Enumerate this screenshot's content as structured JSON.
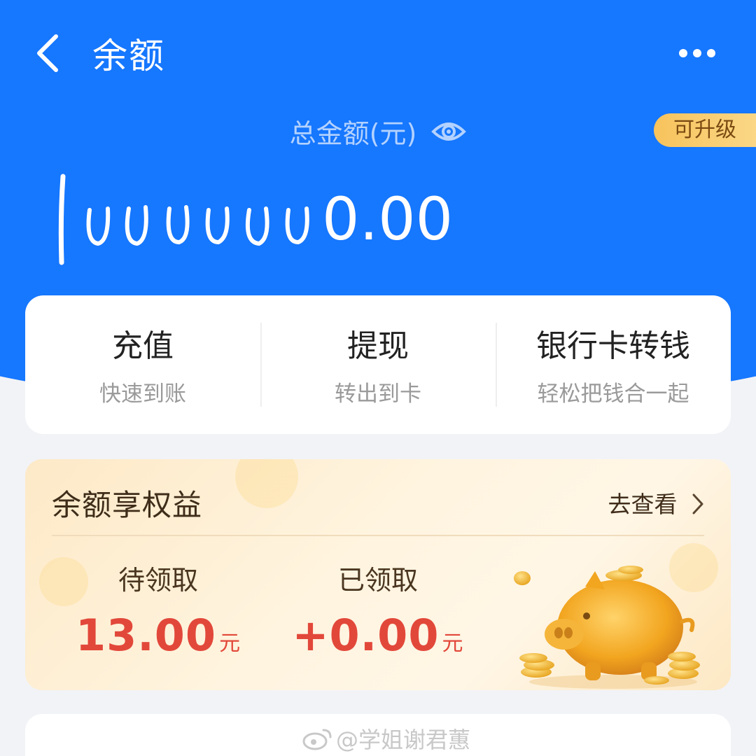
{
  "nav": {
    "title": "余额",
    "back_icon": "chevron-left-icon",
    "more_icon": "more-dots-icon"
  },
  "summary": {
    "total_label": "总金额(元)",
    "eye_icon": "eye-icon",
    "upgrade_label": "可升级",
    "amount_handwritten": "1",
    "amount_display": "0000000.00"
  },
  "actions": [
    {
      "title": "充值",
      "subtitle": "快速到账"
    },
    {
      "title": "提现",
      "subtitle": "转出到卡"
    },
    {
      "title": "银行卡转钱",
      "subtitle": "轻松把钱合一起"
    }
  ],
  "benefits": {
    "title": "余额享权益",
    "view_label": "去查看",
    "pending": {
      "label": "待领取",
      "value": "13.00",
      "unit": "元"
    },
    "received": {
      "label": "已领取",
      "value": "+0.00",
      "unit": "元"
    }
  },
  "watermark": {
    "text": "@学姐谢君蕙"
  },
  "colors": {
    "header_blue": "#1677ff",
    "accent_red": "#e2483a",
    "badge_gold": "#f7c35c"
  }
}
